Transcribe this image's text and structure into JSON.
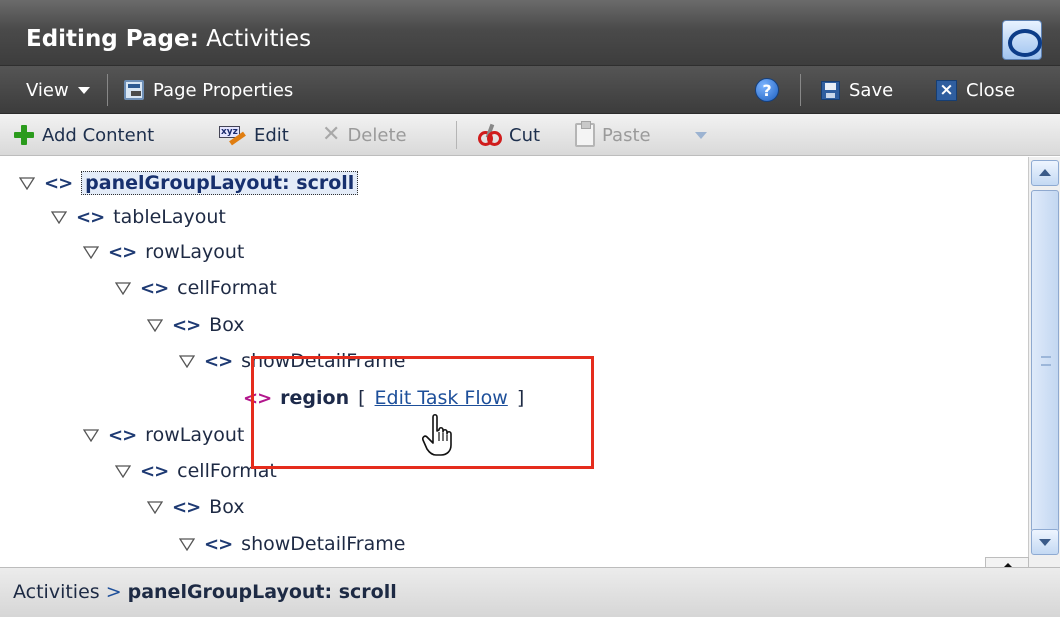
{
  "header": {
    "title_prefix": "Editing Page:",
    "title_page": "Activities",
    "logo_icon": "oracle-o-icon"
  },
  "menubar": {
    "view_label": "View",
    "page_properties_label": "Page Properties",
    "help_label": "?",
    "save_label": "Save",
    "close_label": "Close"
  },
  "toolbar": {
    "add_content_label": "Add Content",
    "edit_label": "Edit",
    "delete_label": "Delete",
    "cut_label": "Cut",
    "paste_label": "Paste"
  },
  "tree": {
    "nodes": [
      {
        "label": "panelGroupLayout: scroll",
        "expanded": true,
        "selected": true
      },
      {
        "label": "tableLayout",
        "expanded": true
      },
      {
        "label": "rowLayout",
        "expanded": true
      },
      {
        "label": "cellFormat",
        "expanded": true
      },
      {
        "label": "Box",
        "expanded": true
      },
      {
        "label": "showDetailFrame",
        "expanded": true
      },
      {
        "label": "region",
        "link_label": "Edit Task Flow",
        "bracket_open": "[",
        "bracket_close": "]"
      },
      {
        "label": "rowLayout",
        "expanded": true
      },
      {
        "label": "cellFormat",
        "expanded": true
      },
      {
        "label": "Box",
        "expanded": true
      },
      {
        "label": "showDetailFrame",
        "expanded": true
      }
    ]
  },
  "breadcrumb": {
    "root": "Activities",
    "separator": ">",
    "current": "panelGroupLayout: scroll"
  },
  "colors": {
    "highlight_box": "#e52c1c",
    "region_icon": "#b2168c",
    "link": "#1d4f9a"
  }
}
